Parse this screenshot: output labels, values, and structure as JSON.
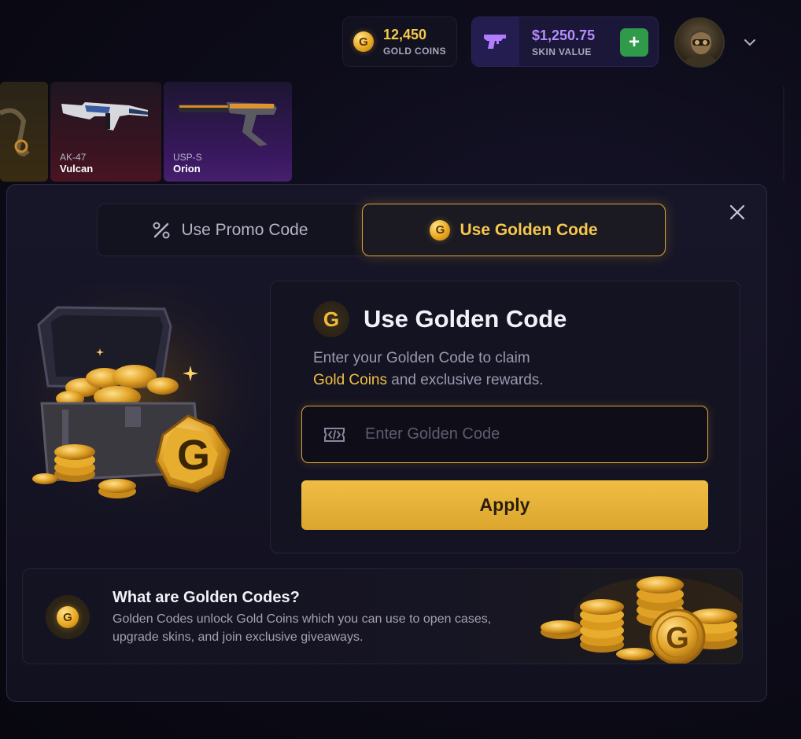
{
  "header": {
    "gold": {
      "value": "12,450",
      "label": "GOLD COINS",
      "coin_letter": "G"
    },
    "skin": {
      "value": "$1,250.75",
      "label": "SKIN VALUE"
    },
    "add_label": "+"
  },
  "skins": [
    {
      "weapon": "AK-47",
      "name": "Vulcan"
    },
    {
      "weapon": "USP-S",
      "name": "Orion"
    }
  ],
  "modal": {
    "tabs": [
      {
        "label": "Use Promo Code",
        "icon": "percent-icon",
        "active": false
      },
      {
        "label": "Use Golden Code",
        "icon": "gold-coin-icon",
        "active": true
      }
    ],
    "panel": {
      "coin_letter": "G",
      "title": "Use Golden Code",
      "desc_line1": "Enter your Golden Code to claim",
      "desc_gold": "Gold Coins",
      "desc_rest": " and exclusive rewards.",
      "input_placeholder": "Enter Golden Code",
      "apply_label": "Apply"
    },
    "info": {
      "coin_letter": "G",
      "title": "What are Golden Codes?",
      "desc": "Golden Codes unlock Gold Coins which you can use to open cases, upgrade skins, and join exclusive giveaways."
    }
  },
  "colors": {
    "gold_accent": "#f2bf45",
    "skin_value": "#b58cff",
    "add_button": "#2f9a4a",
    "apply_button": "#e4ad36"
  }
}
